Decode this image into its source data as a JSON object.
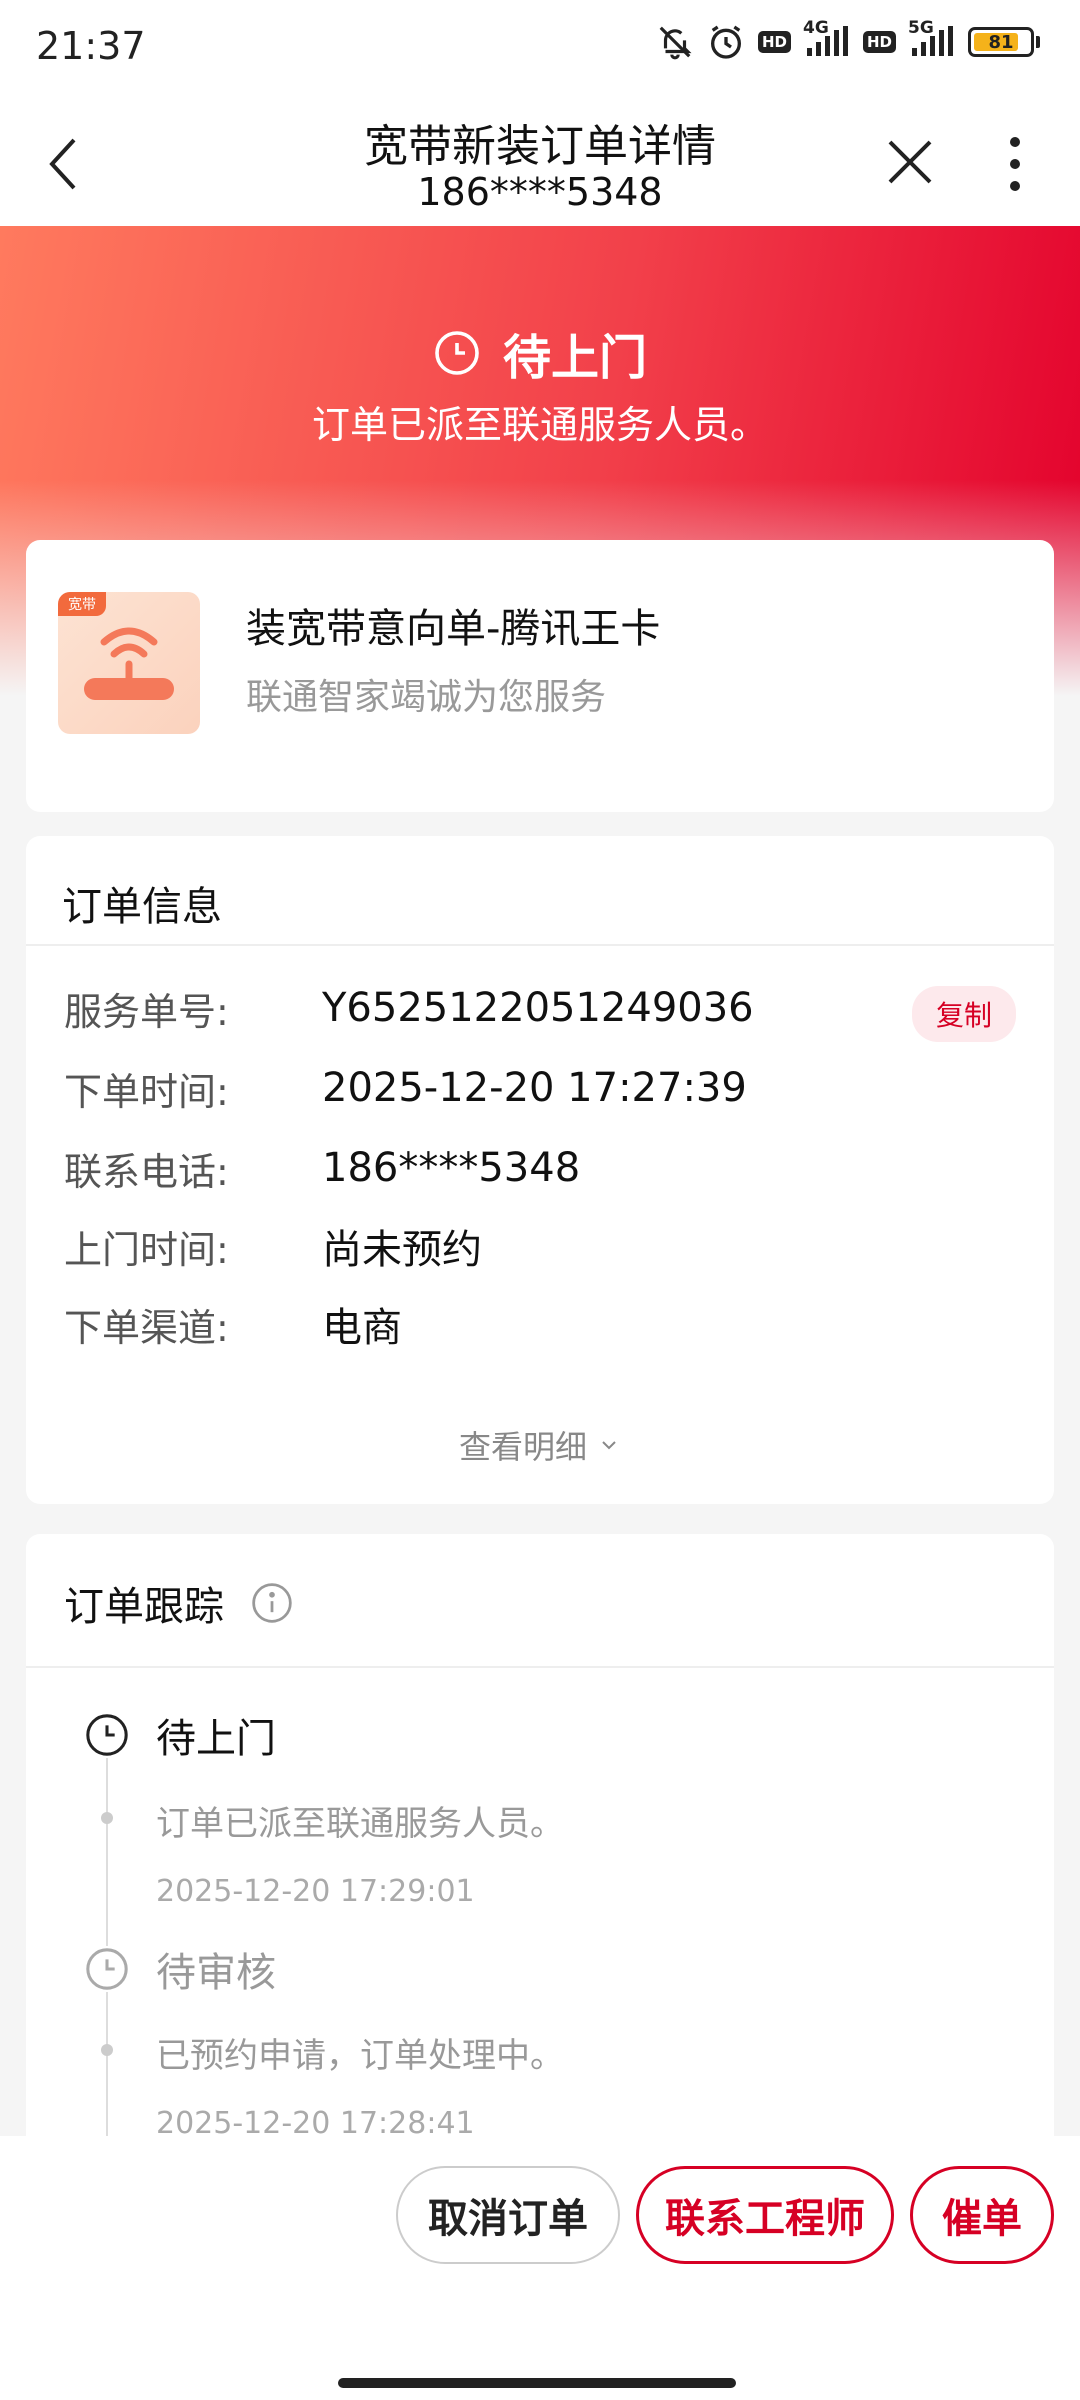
{
  "status_bar": {
    "time": "21:37",
    "network_1": "4G",
    "network_2": "5G",
    "hd_1": "HD",
    "hd_2": "HD",
    "battery": "81",
    "battery_level": 0.81
  },
  "nav": {
    "title": "宽带新装订单详情",
    "subtitle": "186****5348"
  },
  "hero": {
    "status": "待上门",
    "description": "订单已派至联通服务人员。",
    "colors": {
      "start": "#ff7a5e",
      "end": "#e3002c"
    }
  },
  "product": {
    "tag": "宽带",
    "name": "装宽带意向单-腾讯王卡",
    "description": "联通智家竭诚为您服务"
  },
  "order_info": {
    "title": "订单信息",
    "rows": [
      {
        "label": "服务单号:",
        "value": "Y6525122051249036"
      },
      {
        "label": "下单时间:",
        "value": "2025-12-20 17:27:39"
      },
      {
        "label": "联系电话:",
        "value": "186****5348"
      },
      {
        "label": "上门时间:",
        "value": "尚未预约"
      },
      {
        "label": "下单渠道:",
        "value": "电商"
      }
    ],
    "copy_label": "复制",
    "see_more": "查看明细"
  },
  "tracking": {
    "title": "订单跟踪",
    "events": [
      {
        "status": "待上门",
        "description": "订单已派至联通服务人员。",
        "time": "2025-12-20 17:29:01"
      },
      {
        "status": "待审核",
        "description": "已预约申请，订单处理中。",
        "time": "2025-12-20 17:28:41"
      }
    ]
  },
  "actions": {
    "cancel": "取消订单",
    "contact": "联系工程师",
    "urge": "催单"
  },
  "accent_color": "#d60024"
}
